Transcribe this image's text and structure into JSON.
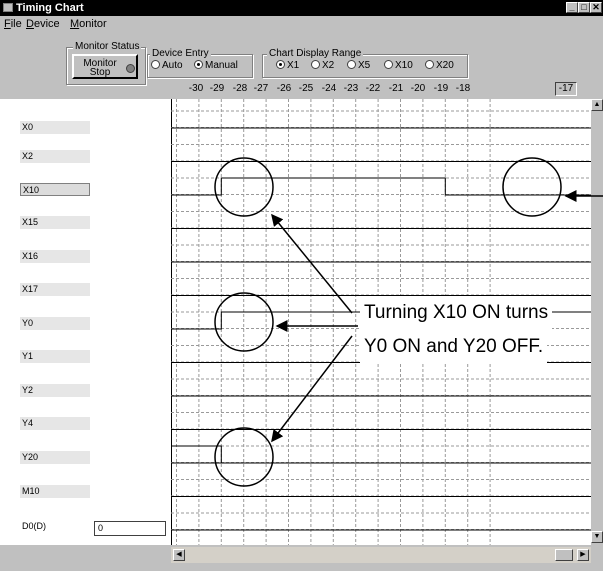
{
  "window": {
    "title": "Timing Chart",
    "buttons": [
      "_",
      "□",
      "✕"
    ]
  },
  "menu": {
    "file": "ile",
    "file_key": "F",
    "device": "evice",
    "device_key": "D",
    "monitor": "onitor",
    "monitor_key": "M"
  },
  "monitor_status": {
    "label": "Monitor Status",
    "button_line1": "Monitor",
    "button_line2": "Stop"
  },
  "device_entry": {
    "label": "Device Entry",
    "options": [
      "Auto",
      "Manual"
    ],
    "selected": "Manual"
  },
  "chart_range": {
    "label": "Chart Display Range",
    "options": [
      "X1",
      "X2",
      "X5",
      "X10",
      "X20"
    ],
    "selected": "X1"
  },
  "ticks": [
    "-30",
    "-29",
    "-28",
    "-27",
    "-26",
    "-25",
    "-24",
    "-23",
    "-22",
    "-21",
    "-20",
    "-19",
    "-18"
  ],
  "current_tick": "-17",
  "devices": [
    "X0",
    "X2",
    "X10",
    "X15",
    "X16",
    "X17",
    "Y0",
    "Y1",
    "Y2",
    "Y4",
    "Y20",
    "M10",
    "D0(D)"
  ],
  "selected_device": "X10",
  "d0_value": "0",
  "annotation": {
    "line1": "Turning X10 ON turns",
    "line2": "Y0 ON and Y20 OFF."
  },
  "signals": {
    "X10": {
      "initial": 0,
      "changes_at": [
        "-28",
        "-18"
      ],
      "steps": [
        "on",
        "off"
      ]
    },
    "Y0": {
      "initial": 0,
      "changes_at": [
        "-28"
      ],
      "steps": [
        "on"
      ]
    },
    "Y20": {
      "initial": 1,
      "changes_at": [
        "-28"
      ],
      "steps": [
        "off"
      ]
    }
  }
}
